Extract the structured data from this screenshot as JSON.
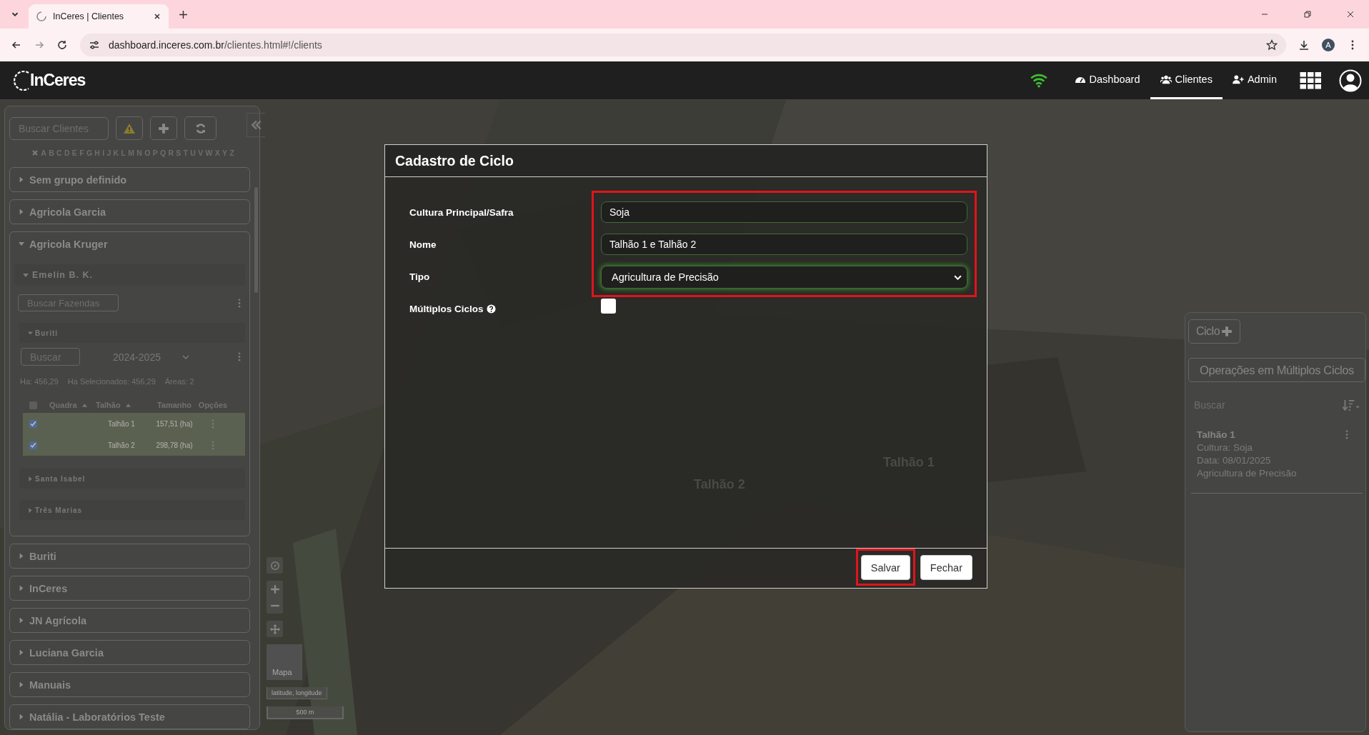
{
  "browser": {
    "tab_title": "InCeres | Clientes",
    "url_host": "dashboard.inceres.com.br",
    "url_path": "/clientes.html#!/clients",
    "profile_initial": "A"
  },
  "header": {
    "logo": "InCeres",
    "nav": [
      {
        "label": "Dashboard",
        "selected": false
      },
      {
        "label": "Clientes",
        "selected": true
      },
      {
        "label": "Admin",
        "selected": false
      }
    ]
  },
  "sidebar": {
    "search_placeholder": "Buscar Clientes",
    "letters": [
      "A",
      "B",
      "C",
      "D",
      "E",
      "F",
      "G",
      "H",
      "I",
      "J",
      "K",
      "L",
      "M",
      "N",
      "O",
      "P",
      "Q",
      "R",
      "S",
      "T",
      "U",
      "V",
      "W",
      "X",
      "Y",
      "Z"
    ],
    "groups": [
      {
        "name": "Sem grupo definido",
        "expanded": false
      },
      {
        "name": "Agricola Garcia",
        "expanded": false
      },
      {
        "name": "Agricola Kruger",
        "expanded": true,
        "children": [
          {
            "name": "Emelin B. K.",
            "expanded": true,
            "search_placeholder": "Buscar Fazendas",
            "children": [
              {
                "name": "Buriti",
                "expanded": true,
                "search_placeholder": "Buscar",
                "season": "2024-2025",
                "stats": [
                  "Ha: 456,29",
                  "Ha Selecionados: 456,29",
                  "Áreas: 2"
                ],
                "select_all_checked": false,
                "columns": [
                  {
                    "label": "Quadra",
                    "sortable": true
                  },
                  {
                    "label": "Talhão",
                    "sortable": true
                  },
                  {
                    "label": "Tamanho",
                    "sortable": false
                  },
                  {
                    "label": "Opções",
                    "sortable": false
                  }
                ],
                "rows": [
                  {
                    "talhao": "Talhão 1",
                    "size": "157,51 (ha)",
                    "checked": true
                  },
                  {
                    "talhao": "Talhão 2",
                    "size": "298,78 (ha)",
                    "checked": true
                  }
                ]
              },
              {
                "name": "Santa Isabel",
                "expanded": false
              },
              {
                "name": "Três Marias",
                "expanded": false
              }
            ]
          }
        ]
      },
      {
        "name": "Buriti",
        "expanded": false
      },
      {
        "name": "InCeres",
        "expanded": false
      },
      {
        "name": "JN Agrícola",
        "expanded": false
      },
      {
        "name": "Luciana Garcia",
        "expanded": false
      },
      {
        "name": "Manuais",
        "expanded": false
      },
      {
        "name": "Natália - Laboratórios Teste",
        "expanded": false
      }
    ]
  },
  "map": {
    "labels": [
      "Talhão 1",
      "Talhão 2"
    ],
    "minimap_label": "Mapa",
    "coordinates": "latitude, longitude",
    "scale": "500 m"
  },
  "modal": {
    "title": "Cadastro de Ciclo",
    "fields_highlighted": true,
    "fields": [
      {
        "label": "Cultura Principal/Safra",
        "kind": "text",
        "value": "Soja"
      },
      {
        "label": "Nome",
        "kind": "text",
        "value": "Talhão 1 e Talhão 2"
      },
      {
        "label": "Tipo",
        "kind": "select",
        "value": "Agricultura de Precisão"
      },
      {
        "label": "Múltiplos Ciclos",
        "kind": "checkbox",
        "checked": false,
        "has_help": true
      }
    ],
    "buttons": [
      {
        "label": "Salvar",
        "highlighted": true
      },
      {
        "label": "Fechar",
        "highlighted": false
      }
    ]
  },
  "right_panel": {
    "new_button": "Ciclo",
    "multi_button": "Operações em Múltiplos Ciclos",
    "search_placeholder": "Buscar",
    "cycles": [
      {
        "name": "Talhão 1",
        "lines": [
          "Cultura: Soja",
          "Data: 08/01/2025",
          "Agricultura de Precisão"
        ]
      }
    ]
  }
}
